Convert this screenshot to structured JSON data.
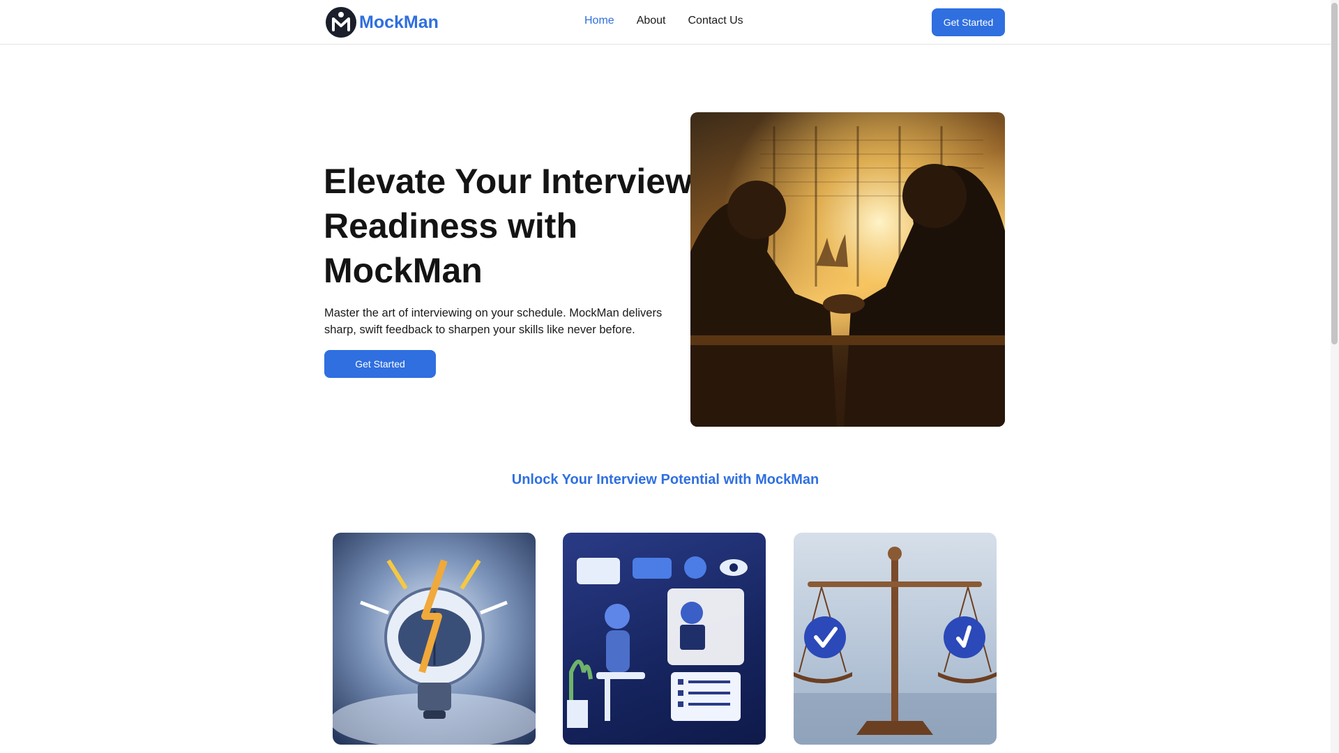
{
  "brand": {
    "name": "MockMan",
    "logo_icon": "m-logo-icon"
  },
  "nav": {
    "links": [
      {
        "label": "Home",
        "active": true
      },
      {
        "label": "About",
        "active": false
      },
      {
        "label": "Contact Us",
        "active": false
      }
    ],
    "cta_label": "Get Started"
  },
  "hero": {
    "title": "Elevate Your Interview Readiness with MockMan",
    "subtitle": "Master the art of interviewing on your schedule. MockMan delivers sharp, swift feedback to sharpen your skills like never before.",
    "cta_label": "Get Started",
    "image_icon": "handshake-illustration"
  },
  "features": {
    "title": "Unlock Your Interview Potential with MockMan",
    "cards": [
      {
        "icon": "lightbulb-brain-icon"
      },
      {
        "icon": "robot-interview-icon"
      },
      {
        "icon": "balance-scale-icon"
      }
    ]
  },
  "colors": {
    "accent": "#2f6fe0",
    "text": "#141414",
    "border": "#e2e2e2"
  }
}
